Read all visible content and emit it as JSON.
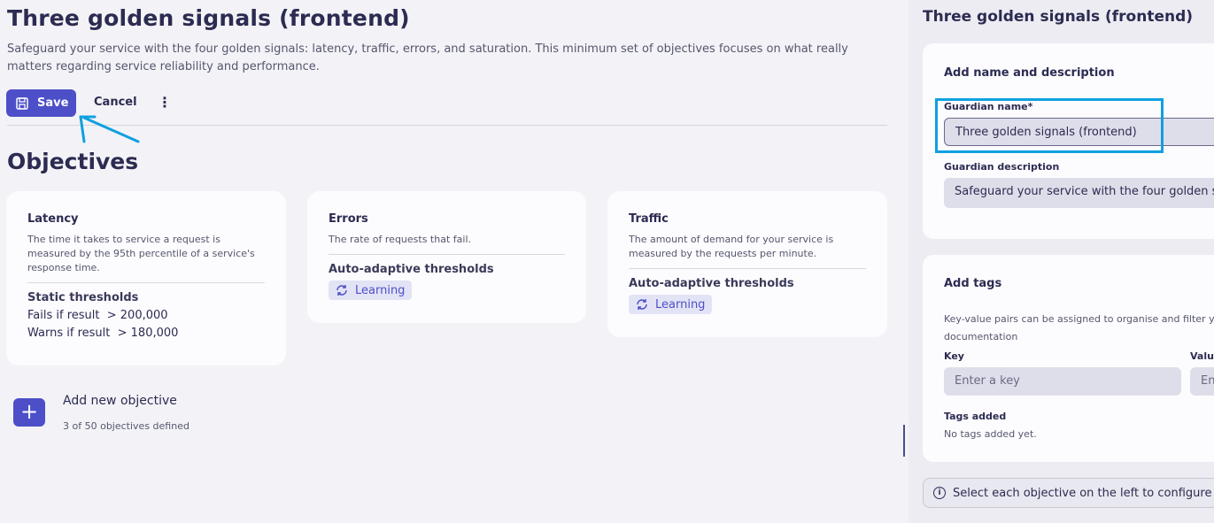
{
  "header": {
    "title": "Three golden signals (frontend)",
    "description": "Safeguard your service with the four golden signals: latency, traffic, errors, and saturation. This minimum set of objectives focuses on what really matters regarding service reliability and performance."
  },
  "toolbar": {
    "save_label": "Save",
    "cancel_label": "Cancel",
    "more_label": "⋮"
  },
  "objectives": {
    "heading": "Objectives",
    "cards": [
      {
        "title": "Latency",
        "description": "The time it takes to service a request is measured by the 95th percentile of a service's response time.",
        "threshold_type": "Static thresholds",
        "fails_label": "Fails if result",
        "fails_value": "> 200,000",
        "warns_label": "Warns if result",
        "warns_value": "> 180,000"
      },
      {
        "title": "Errors",
        "description": "The rate of requests that fail.",
        "threshold_type": "Auto-adaptive thresholds",
        "badge": "Learning"
      },
      {
        "title": "Traffic",
        "description": "The amount of demand for your service is measured by the requests per minute.",
        "threshold_type": "Auto-adaptive thresholds",
        "badge": "Learning"
      }
    ],
    "add_label": "Add new objective",
    "count_text": "3 of 50 objectives defined"
  },
  "sidebar": {
    "title": "Three golden signals (frontend)",
    "name_section": {
      "heading": "Add name and description",
      "name_label": "Guardian name*",
      "name_value": "Three golden signals (frontend)",
      "description_label": "Guardian description",
      "description_value": "Safeguard your service with the four golden signals: latency, traffic, errors, and saturation."
    },
    "tags_section": {
      "heading": "Add tags",
      "help_text_line1": "Key-value pairs can be assigned to organise and filter your",
      "help_text_line2": "documentation",
      "key_label": "Key",
      "key_placeholder": "Enter a key",
      "value_label": "Value",
      "value_placeholder": "Enter a value",
      "tags_added_label": "Tags added",
      "tags_added_text": "No tags added yet."
    },
    "info_text": "Select each objective on the left to configure it."
  },
  "colors": {
    "accent": "#4d4fc8",
    "highlight": "#10a0e0",
    "annotation_arrow": "#10a0e0"
  }
}
